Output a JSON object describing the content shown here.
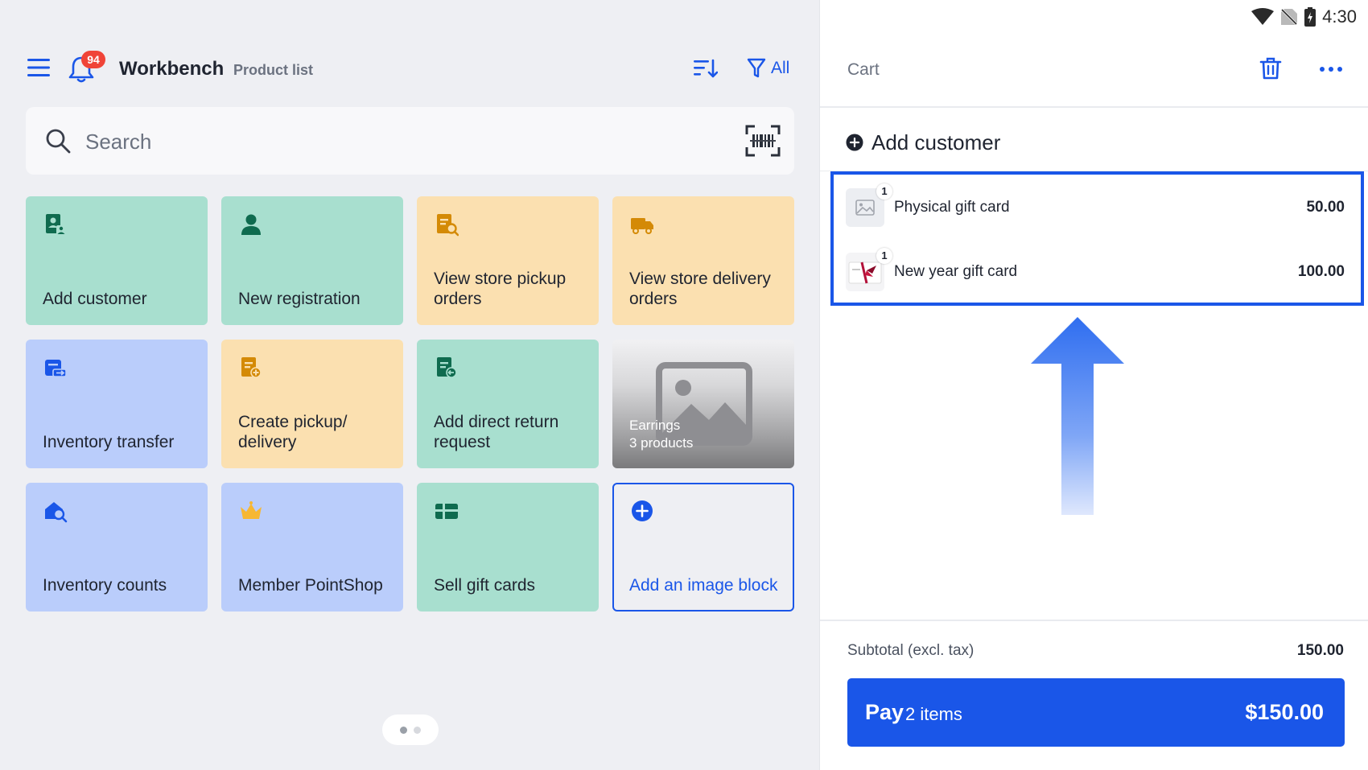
{
  "header": {
    "title": "Workbench",
    "subtitle": "Product list",
    "notification_count": "94",
    "filter_label": "All"
  },
  "search": {
    "placeholder": "Search"
  },
  "tiles": [
    {
      "label": "Add customer",
      "icon": "customer-card-icon",
      "color": "#a8dfcf"
    },
    {
      "label": "New registration",
      "icon": "person-icon",
      "color": "#a8dfcf"
    },
    {
      "label": "View store pickup orders",
      "icon": "pickup-order-icon",
      "color": "#fbe0b0"
    },
    {
      "label": "View store delivery orders",
      "icon": "delivery-truck-icon",
      "color": "#fbe0b0"
    },
    {
      "label": "Inventory transfer",
      "icon": "inventory-transfer-icon",
      "color": "#bacdfb"
    },
    {
      "label": "Create pickup/ delivery",
      "icon": "create-pickup-icon",
      "color": "#fbe0b0"
    },
    {
      "label": "Add direct return request",
      "icon": "return-request-icon",
      "color": "#a8dfcf"
    },
    {
      "label": "Earrings",
      "sublabel": "3 products",
      "icon": "image-placeholder-icon"
    },
    {
      "label": "Inventory counts",
      "icon": "inventory-count-icon",
      "color": "#bacdfb"
    },
    {
      "label": "Member PointShop",
      "icon": "crown-icon",
      "color": "#bacdfb"
    },
    {
      "label": "Sell gift cards",
      "icon": "gift-card-icon",
      "color": "#a8dfcf"
    },
    {
      "label": "Add an image block",
      "icon": "plus-circle-icon"
    }
  ],
  "statusbar": {
    "time": "4:30"
  },
  "cart": {
    "title": "Cart",
    "add_customer": "Add customer",
    "items": [
      {
        "name": "Physical gift card",
        "qty": "1",
        "price": "50.00"
      },
      {
        "name": "New year gift card",
        "qty": "1",
        "price": "100.00"
      }
    ],
    "subtotal_label": "Subtotal (excl. tax)",
    "subtotal_value": "150.00",
    "pay": {
      "label": "Pay",
      "count": "2 items",
      "amount": "$150.00"
    }
  },
  "colors": {
    "accent": "#1a56e8",
    "badge": "#f04438",
    "green_tile": "#a8dfcf",
    "orange_tile": "#fbe0b0",
    "blue_tile": "#bacdfb"
  }
}
